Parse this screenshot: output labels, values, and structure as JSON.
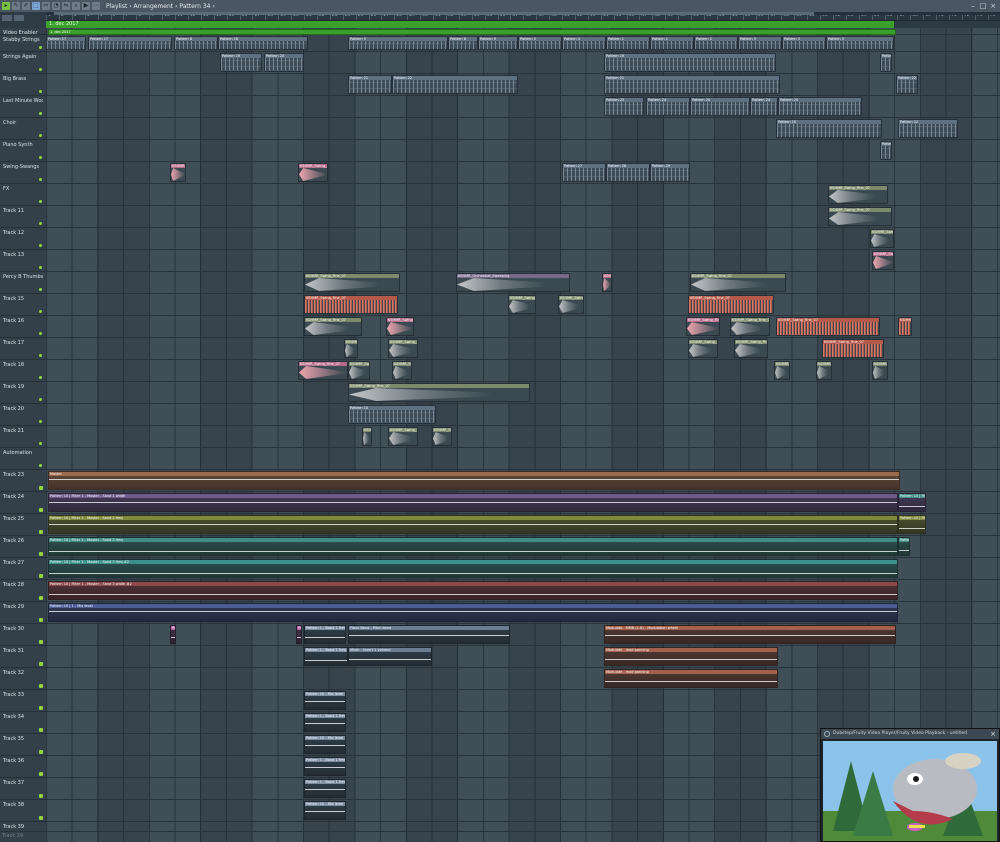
{
  "toolbar": {
    "breadcrumb": "Playlist › Arrangement › Pattern 34 ›"
  },
  "marker": {
    "label": "1. dec 2017"
  },
  "tracks": [
    {
      "name": "Video Enabler"
    },
    {
      "name": "Stabby Strings"
    },
    {
      "name": "Strings Again"
    },
    {
      "name": "Big Brass"
    },
    {
      "name": "Last Minute Woodwinds"
    },
    {
      "name": "Choir"
    },
    {
      "name": "Piano Synth"
    },
    {
      "name": "Swing-Swangs"
    },
    {
      "name": "FX"
    },
    {
      "name": "Track 11"
    },
    {
      "name": "Track 12"
    },
    {
      "name": "Track 13"
    },
    {
      "name": "Percy B Thumbs"
    },
    {
      "name": "Track 15"
    },
    {
      "name": "Track 16"
    },
    {
      "name": "Track 17"
    },
    {
      "name": "Track 18"
    },
    {
      "name": "Track 19"
    },
    {
      "name": "Track 20"
    },
    {
      "name": "Track 21"
    },
    {
      "name": "Automation"
    },
    {
      "name": "Track 23"
    },
    {
      "name": "Track 24"
    },
    {
      "name": "Track 25"
    },
    {
      "name": "Track 26"
    },
    {
      "name": "Track 27"
    },
    {
      "name": "Track 28"
    },
    {
      "name": "Track 29"
    },
    {
      "name": "Track 30"
    },
    {
      "name": "Track 31"
    },
    {
      "name": "Track 32"
    },
    {
      "name": "Track 33"
    },
    {
      "name": "Track 34"
    },
    {
      "name": "Track 35"
    },
    {
      "name": "Track 36"
    },
    {
      "name": "Track 37"
    },
    {
      "name": "Track 38"
    },
    {
      "name": "Track 39"
    }
  ],
  "clip_labels": {
    "pattern_17": "Pattern 17",
    "pattern_6": "Pattern 6",
    "pattern_18": "Pattern 18",
    "pattern_5": "Pattern 5",
    "pattern_8": "Pattern 8",
    "pattern_9": "Pattern 9",
    "pattern_4": "Pattern 4",
    "pattern_1": "Pattern 1",
    "pattern_2": "Pattern 2",
    "pattern_3": "Pattern 3",
    "pattern_19": "Pattern 19",
    "pattern_20": "Pattern 20",
    "pattern_26": "Pattern 26",
    "pattern_21": "Pattern 21",
    "pattern_22": "Pattern 22",
    "pattern_23": "Pattern 23",
    "pattern_24": "Pattern 24",
    "pattern_25": "Pattern 25",
    "pattern_10": "Pattern 10",
    "pattern_11": "Pattern 11",
    "pattern_12": "Pattern 12",
    "pattern_13": "Pattern 13",
    "pattern_27": "Pattern 27",
    "pattern_28": "Pattern 28",
    "pattern_29": "Pattern 29",
    "fx_swing": "KSHMR_Swing_Fine_07",
    "reverse_cym": "KSHMR_Orchestral_Sweeping",
    "automation_main": "Master",
    "auto_24": "Pattern 10 | Filter 1 - Master - Sand 1 width",
    "auto_25": "Pattern 10 | Filter 1 - Master - Sand 2 freq",
    "auto_26": "Pattern 10 | Filter 1 - Master - Sand 3 freq",
    "auto_27": "Pattern 10 | Filter 1 - Master - Sand 3 freq #2",
    "auto_28": "Pattern 10 | Filter 1 - Master - Sand 3 width #2",
    "auto_29": "Pattern 10 | 1 - Mix level",
    "auto_30a": "Pattern 1 - Band 1 freq",
    "auto_30b": "Flexx Bend - Pitch bend",
    "auto_30c": "Modulate - MMB (1-8) - Modulation wheel",
    "auto_31a": "Pattern 1 - Band 1 freq",
    "auto_31b": "Mixer - Insert 1 volume",
    "auto_31c": "Modulate - mod panning",
    "auto_33": "Pattern 10 - Mix level",
    "auto_34": "Pattern 1 - Band 1 freq",
    "auto_35": "Pattern 10 - Mix level",
    "auto_36": "Pattern 1 - Band 1 freq",
    "auto_37": "Pattern 1 - Band 1 freq",
    "auto_38": "Pattern 10 - Mix level",
    "video_clip": "1. dec 2017"
  },
  "video_window": {
    "title": "Dubstep/Fruity Video Player/Fruity Video Playback - untitled"
  },
  "colors": {
    "marker": "#3aa02c",
    "led": "#93d53b",
    "auto_master": "#9b6a4b",
    "auto_purple": "#6e5b8c",
    "auto_olive": "#7f8a3f",
    "auto_teal": "#3f8d86",
    "auto_teal2": "#3b8f8a",
    "auto_red": "#8d4a4a",
    "auto_blue": "#4b5d93"
  }
}
